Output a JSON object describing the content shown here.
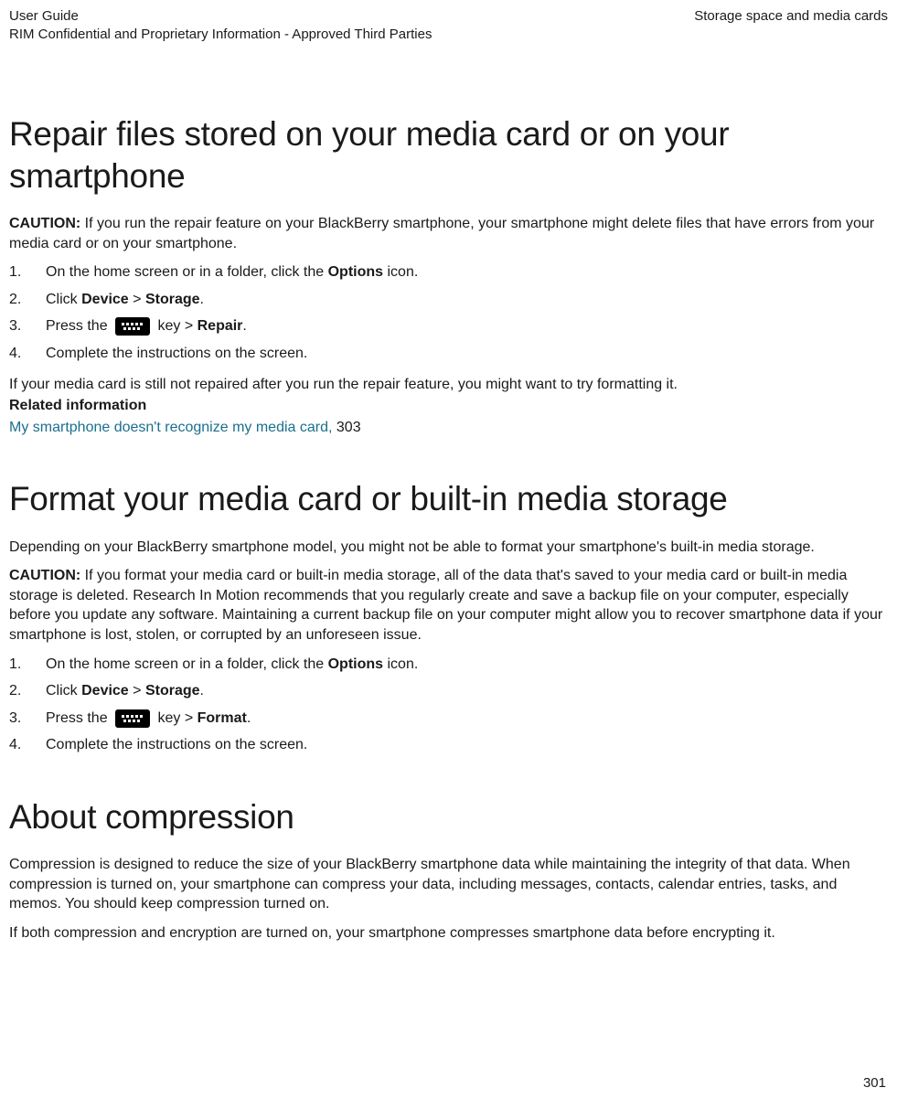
{
  "header": {
    "left1": "User Guide",
    "left2": "RIM Confidential and Proprietary Information - Approved Third Parties",
    "right": "Storage space and media cards"
  },
  "s1": {
    "title": "Repair files stored on your media card or on your smartphone",
    "cautionLabel": "CAUTION: ",
    "caution": "If you run the repair feature on your BlackBerry smartphone, your smartphone might delete files that have errors from your media card or on your smartphone.",
    "step1a": "On the home screen or in a folder, click the ",
    "step1b": "Options",
    "step1c": " icon.",
    "step2a": "Click ",
    "step2b": "Device",
    "step2c": " > ",
    "step2d": "Storage",
    "step2e": ".",
    "step3a": "Press the ",
    "step3b": " key > ",
    "step3c": "Repair",
    "step3d": ".",
    "step4": "Complete the instructions on the screen.",
    "after": "If your media card is still not repaired after you run the repair feature, you might want to try formatting it.",
    "relatedLabel": "Related information",
    "link": "My smartphone doesn't recognize my media card, ",
    "linkPage": "303"
  },
  "s2": {
    "title": "Format your media card or built-in media storage",
    "intro": "Depending on your BlackBerry smartphone model, you might not be able to format your smartphone's built-in media storage.",
    "cautionLabel": "CAUTION: ",
    "caution": "If you format your media card or built-in media storage, all of the data that's saved to your media card or built-in media storage is deleted. Research In Motion recommends that you regularly create and save a backup file on your computer, especially before you update any software. Maintaining a current backup file on your computer might allow you to recover smartphone data if your smartphone is lost, stolen, or corrupted by an unforeseen issue.",
    "step1a": "On the home screen or in a folder, click the ",
    "step1b": "Options",
    "step1c": " icon.",
    "step2a": "Click ",
    "step2b": "Device",
    "step2c": " > ",
    "step2d": "Storage",
    "step2e": ".",
    "step3a": "Press the ",
    "step3b": " key > ",
    "step3c": "Format",
    "step3d": ".",
    "step4": "Complete the instructions on the screen."
  },
  "s3": {
    "title": "About compression",
    "p1": "Compression is designed to reduce the size of your BlackBerry smartphone data while maintaining the integrity of that data. When compression is turned on, your smartphone can compress your data, including messages, contacts, calendar entries, tasks, and memos. You should keep compression turned on.",
    "p2": "If both compression and encryption are turned on, your smartphone compresses smartphone data before encrypting it."
  },
  "pageNumber": "301"
}
